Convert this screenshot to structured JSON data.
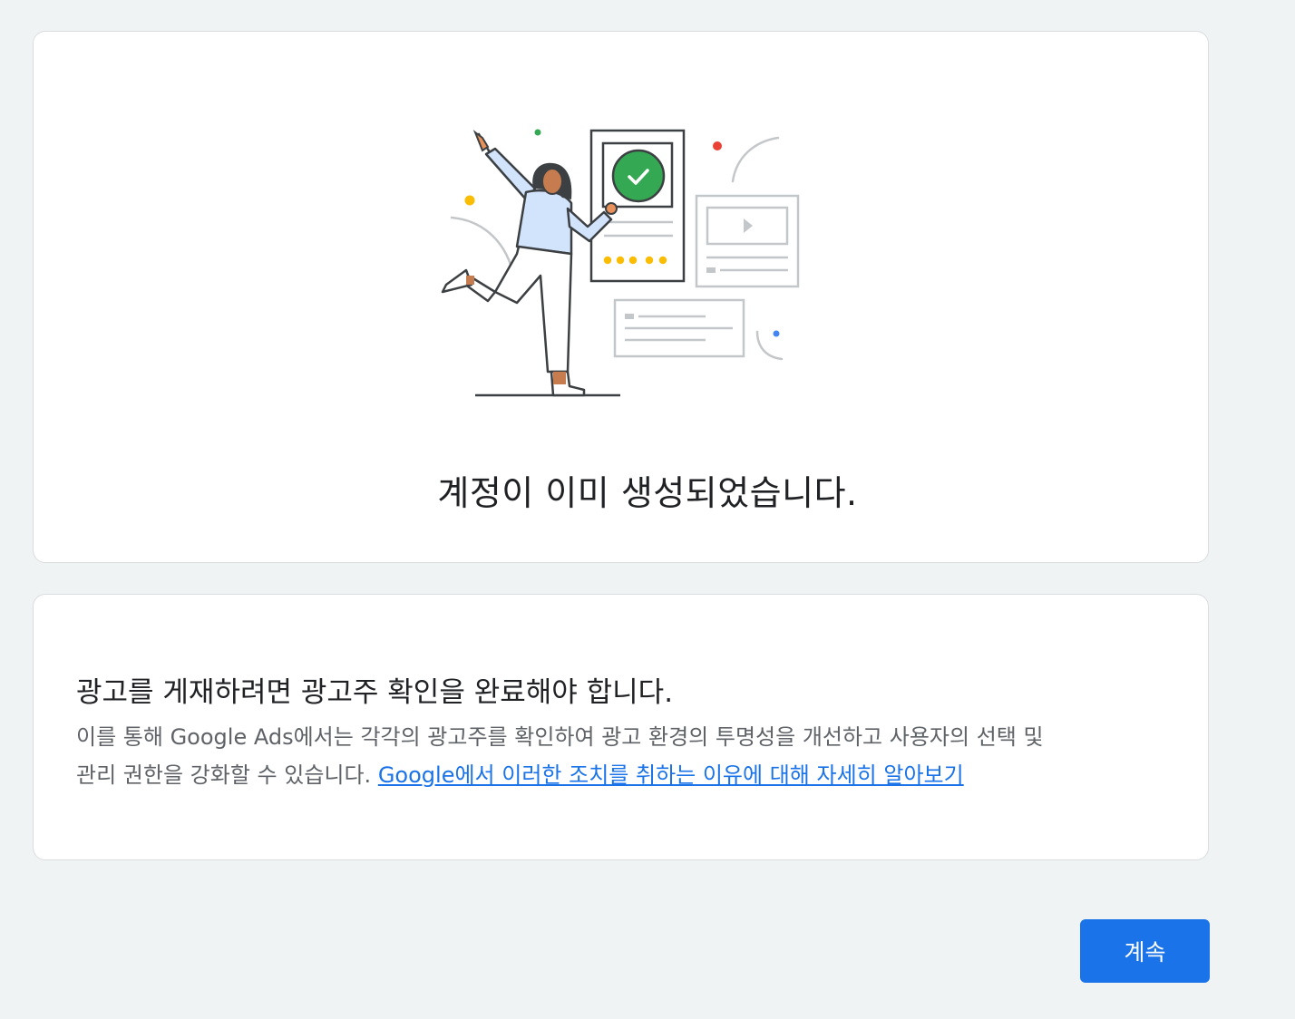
{
  "status_card": {
    "illustration_icon": "person-celebrating-checkmark-illustration",
    "headline": "계정이 이미 생성되었습니다."
  },
  "verification_card": {
    "title": "광고를 게재하려면 광고주 확인을 완료해야 합니다.",
    "body_line1": "이를 통해 Google Ads에서는 각각의 광고주를 확인하여 광고 환경의 투명성을 개선하고 사용자의 선택 및",
    "body_line2": "관리 권한을 강화할 수 있습니다. ",
    "learn_more_link": "Google에서 이러한 조치를 취하는 이유에 대해 자세히 알아보기"
  },
  "actions": {
    "continue_label": "계속"
  },
  "colors": {
    "background": "#f0f3f4",
    "card": "#ffffff",
    "accent": "#1a73e8",
    "check_green": "#34a853",
    "dot_yellow": "#fbbc04",
    "dot_red": "#ea4335",
    "dot_blue": "#4285f4"
  }
}
